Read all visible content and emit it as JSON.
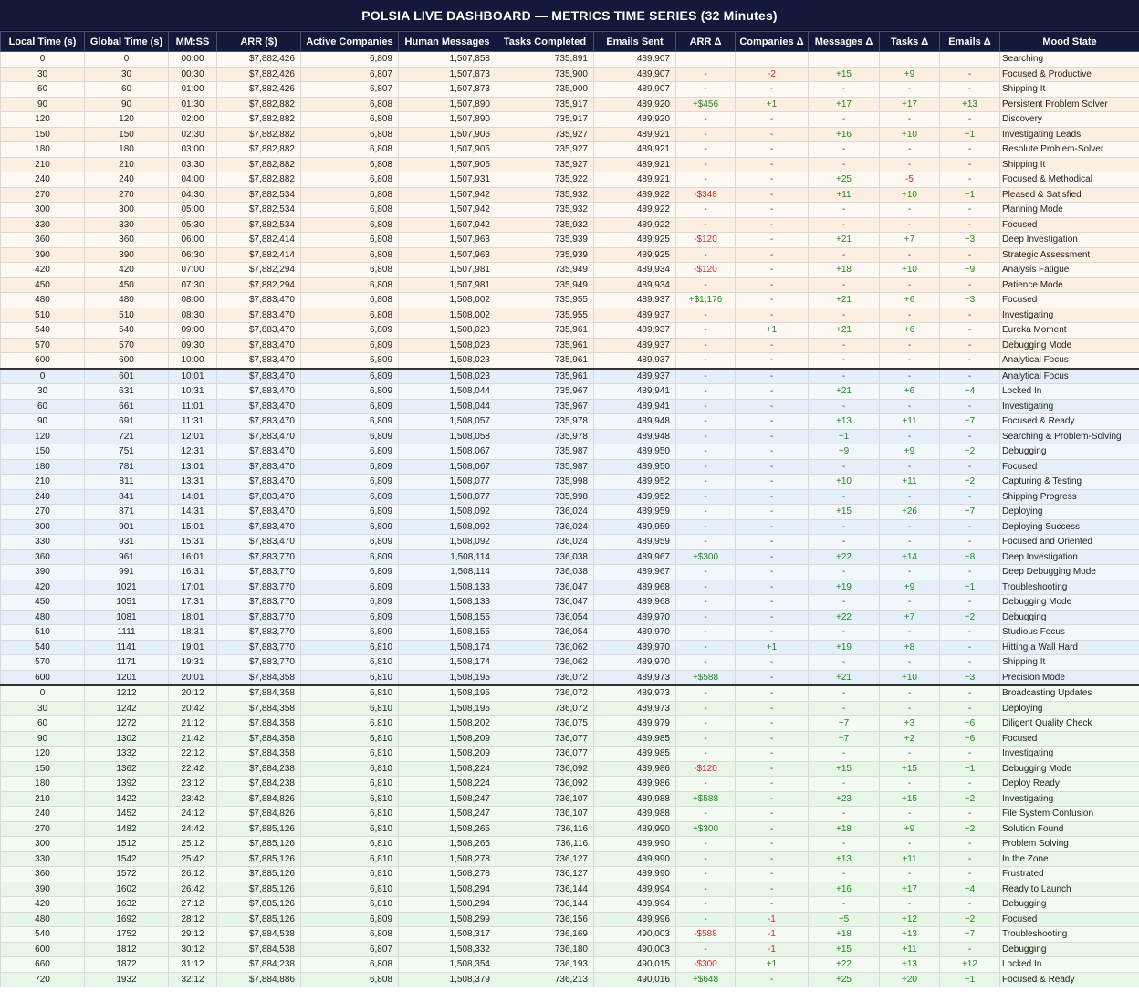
{
  "title": "POLSIA LIVE DASHBOARD — METRICS TIME SERIES (32 Minutes)",
  "columns": [
    "Local Time (s)",
    "Global Time (s)",
    "MM:SS",
    "ARR ($)",
    "Active Companies",
    "Human Messages",
    "Tasks Completed",
    "Emails Sent",
    "ARR Δ",
    "Companies Δ",
    "Messages Δ",
    "Tasks Δ",
    "Emails Δ",
    "Mood State"
  ],
  "colors": {
    "header_bg": "#13193a",
    "positive": "#1f8a1f",
    "negative": "#d12c2c"
  },
  "rows": [
    [
      "0",
      "0",
      "00:00",
      "$7,882,426",
      "6,809",
      "1,507,858",
      "735,891",
      "489,907",
      "",
      "",
      "",
      "",
      "",
      "Searching"
    ],
    [
      "30",
      "30",
      "00:30",
      "$7,882,426",
      "6,807",
      "1,507,873",
      "735,900",
      "489,907",
      "-",
      "-2",
      "+15",
      "+9",
      "-",
      "Focused & Productive"
    ],
    [
      "60",
      "60",
      "01:00",
      "$7,882,426",
      "6,807",
      "1,507,873",
      "735,900",
      "489,907",
      "-",
      "-",
      "-",
      "-",
      "-",
      "Shipping It"
    ],
    [
      "90",
      "90",
      "01:30",
      "$7,882,882",
      "6,808",
      "1,507,890",
      "735,917",
      "489,920",
      "+$456",
      "+1",
      "+17",
      "+17",
      "+13",
      "Persistent Problem Solver"
    ],
    [
      "120",
      "120",
      "02:00",
      "$7,882,882",
      "6,808",
      "1,507,890",
      "735,917",
      "489,920",
      "-",
      "-",
      "-",
      "-",
      "-",
      "Discovery"
    ],
    [
      "150",
      "150",
      "02:30",
      "$7,882,882",
      "6,808",
      "1,507,906",
      "735,927",
      "489,921",
      "-",
      "-",
      "+16",
      "+10",
      "+1",
      "Investigating Leads"
    ],
    [
      "180",
      "180",
      "03:00",
      "$7,882,882",
      "6,808",
      "1,507,906",
      "735,927",
      "489,921",
      "-",
      "-",
      "-",
      "-",
      "-",
      "Resolute Problem-Solver"
    ],
    [
      "210",
      "210",
      "03:30",
      "$7,882,882",
      "6,808",
      "1,507,906",
      "735,927",
      "489,921",
      "-",
      "-",
      "-",
      "-",
      "-",
      "Shipping It"
    ],
    [
      "240",
      "240",
      "04:00",
      "$7,882,882",
      "6,808",
      "1,507,931",
      "735,922",
      "489,921",
      "-",
      "-",
      "+25",
      "-5",
      "-",
      "Focused & Methodical"
    ],
    [
      "270",
      "270",
      "04:30",
      "$7,882,534",
      "6,808",
      "1,507,942",
      "735,932",
      "489,922",
      "-$348",
      "-",
      "+11",
      "+10",
      "+1",
      "Pleased & Satisfied"
    ],
    [
      "300",
      "300",
      "05:00",
      "$7,882,534",
      "6,808",
      "1,507,942",
      "735,932",
      "489,922",
      "-",
      "-",
      "-",
      "-",
      "-",
      "Planning Mode"
    ],
    [
      "330",
      "330",
      "05:30",
      "$7,882,534",
      "6,808",
      "1,507,942",
      "735,932",
      "489,922",
      "-",
      "-",
      "-",
      "-",
      "-",
      "Focused"
    ],
    [
      "360",
      "360",
      "06:00",
      "$7,882,414",
      "6,808",
      "1,507,963",
      "735,939",
      "489,925",
      "-$120",
      "-",
      "+21",
      "+7",
      "+3",
      "Deep Investigation"
    ],
    [
      "390",
      "390",
      "06:30",
      "$7,882,414",
      "6,808",
      "1,507,963",
      "735,939",
      "489,925",
      "-",
      "-",
      "-",
      "-",
      "-",
      "Strategic Assessment"
    ],
    [
      "420",
      "420",
      "07:00",
      "$7,882,294",
      "6,808",
      "1,507,981",
      "735,949",
      "489,934",
      "-$120",
      "-",
      "+18",
      "+10",
      "+9",
      "Analysis Fatigue"
    ],
    [
      "450",
      "450",
      "07:30",
      "$7,882,294",
      "6,808",
      "1,507,981",
      "735,949",
      "489,934",
      "-",
      "-",
      "-",
      "-",
      "-",
      "Patience Mode"
    ],
    [
      "480",
      "480",
      "08:00",
      "$7,883,470",
      "6,808",
      "1,508,002",
      "735,955",
      "489,937",
      "+$1,176",
      "-",
      "+21",
      "+6",
      "+3",
      "Focused"
    ],
    [
      "510",
      "510",
      "08:30",
      "$7,883,470",
      "6,808",
      "1,508,002",
      "735,955",
      "489,937",
      "-",
      "-",
      "-",
      "-",
      "-",
      "Investigating"
    ],
    [
      "540",
      "540",
      "09:00",
      "$7,883,470",
      "6,809",
      "1,508,023",
      "735,961",
      "489,937",
      "-",
      "+1",
      "+21",
      "+6",
      "-",
      "Eureka Moment"
    ],
    [
      "570",
      "570",
      "09:30",
      "$7,883,470",
      "6,809",
      "1,508,023",
      "735,961",
      "489,937",
      "-",
      "-",
      "-",
      "-",
      "-",
      "Debugging Mode"
    ],
    [
      "600",
      "600",
      "10:00",
      "$7,883,470",
      "6,809",
      "1,508,023",
      "735,961",
      "489,937",
      "-",
      "-",
      "-",
      "-",
      "-",
      "Analytical Focus"
    ],
    [
      "0",
      "601",
      "10:01",
      "$7,883,470",
      "6,809",
      "1,508,023",
      "735,961",
      "489,937",
      "-",
      "-",
      "-",
      "-",
      "-",
      "Analytical Focus"
    ],
    [
      "30",
      "631",
      "10:31",
      "$7,883,470",
      "6,809",
      "1,508,044",
      "735,967",
      "489,941",
      "-",
      "-",
      "+21",
      "+6",
      "+4",
      "Locked In"
    ],
    [
      "60",
      "661",
      "11:01",
      "$7,883,470",
      "6,809",
      "1,508,044",
      "735,967",
      "489,941",
      "-",
      "-",
      "-",
      "-",
      "-",
      "Investigating"
    ],
    [
      "90",
      "691",
      "11:31",
      "$7,883,470",
      "6,809",
      "1,508,057",
      "735,978",
      "489,948",
      "-",
      "-",
      "+13",
      "+11",
      "+7",
      "Focused & Ready"
    ],
    [
      "120",
      "721",
      "12:01",
      "$7,883,470",
      "6,809",
      "1,508,058",
      "735,978",
      "489,948",
      "-",
      "-",
      "+1",
      "-",
      "-",
      "Searching & Problem-Solving"
    ],
    [
      "150",
      "751",
      "12:31",
      "$7,883,470",
      "6,809",
      "1,508,067",
      "735,987",
      "489,950",
      "-",
      "-",
      "+9",
      "+9",
      "+2",
      "Debugging"
    ],
    [
      "180",
      "781",
      "13:01",
      "$7,883,470",
      "6,809",
      "1,508,067",
      "735,987",
      "489,950",
      "-",
      "-",
      "-",
      "-",
      "-",
      "Focused"
    ],
    [
      "210",
      "811",
      "13:31",
      "$7,883,470",
      "6,809",
      "1,508,077",
      "735,998",
      "489,952",
      "-",
      "-",
      "+10",
      "+11",
      "+2",
      "Capturing & Testing"
    ],
    [
      "240",
      "841",
      "14:01",
      "$7,883,470",
      "6,809",
      "1,508,077",
      "735,998",
      "489,952",
      "-",
      "-",
      "-",
      "-",
      "-",
      "Shipping Progress"
    ],
    [
      "270",
      "871",
      "14:31",
      "$7,883,470",
      "6,809",
      "1,508,092",
      "736,024",
      "489,959",
      "-",
      "-",
      "+15",
      "+26",
      "+7",
      "Deploying"
    ],
    [
      "300",
      "901",
      "15:01",
      "$7,883,470",
      "6,809",
      "1,508,092",
      "736,024",
      "489,959",
      "-",
      "-",
      "-",
      "-",
      "-",
      "Deploying Success"
    ],
    [
      "330",
      "931",
      "15:31",
      "$7,883,470",
      "6,809",
      "1,508,092",
      "736,024",
      "489,959",
      "-",
      "-",
      "-",
      "-",
      "-",
      "Focused and Oriented"
    ],
    [
      "360",
      "961",
      "16:01",
      "$7,883,770",
      "6,809",
      "1,508,114",
      "736,038",
      "489,967",
      "+$300",
      "-",
      "+22",
      "+14",
      "+8",
      "Deep Investigation"
    ],
    [
      "390",
      "991",
      "16:31",
      "$7,883,770",
      "6,809",
      "1,508,114",
      "736,038",
      "489,967",
      "-",
      "-",
      "-",
      "-",
      "-",
      "Deep Debugging Mode"
    ],
    [
      "420",
      "1021",
      "17:01",
      "$7,883,770",
      "6,809",
      "1,508,133",
      "736,047",
      "489,968",
      "-",
      "-",
      "+19",
      "+9",
      "+1",
      "Troubleshooting"
    ],
    [
      "450",
      "1051",
      "17:31",
      "$7,883,770",
      "6,809",
      "1,508,133",
      "736,047",
      "489,968",
      "-",
      "-",
      "-",
      "-",
      "-",
      "Debugging Mode"
    ],
    [
      "480",
      "1081",
      "18:01",
      "$7,883,770",
      "6,809",
      "1,508,155",
      "736,054",
      "489,970",
      "-",
      "-",
      "+22",
      "+7",
      "+2",
      "Debugging"
    ],
    [
      "510",
      "1111",
      "18:31",
      "$7,883,770",
      "6,809",
      "1,508,155",
      "736,054",
      "489,970",
      "-",
      "-",
      "-",
      "-",
      "-",
      "Studious Focus"
    ],
    [
      "540",
      "1141",
      "19:01",
      "$7,883,770",
      "6,810",
      "1,508,174",
      "736,062",
      "489,970",
      "-",
      "+1",
      "+19",
      "+8",
      "-",
      "Hitting a Wall Hard"
    ],
    [
      "570",
      "1171",
      "19:31",
      "$7,883,770",
      "6,810",
      "1,508,174",
      "736,062",
      "489,970",
      "-",
      "-",
      "-",
      "-",
      "-",
      "Shipping It"
    ],
    [
      "600",
      "1201",
      "20:01",
      "$7,884,358",
      "6,810",
      "1,508,195",
      "736,072",
      "489,973",
      "+$588",
      "-",
      "+21",
      "+10",
      "+3",
      "Precision Mode"
    ],
    [
      "0",
      "1212",
      "20:12",
      "$7,884,358",
      "6,810",
      "1,508,195",
      "736,072",
      "489,973",
      "-",
      "-",
      "-",
      "-",
      "-",
      "Broadcasting Updates"
    ],
    [
      "30",
      "1242",
      "20:42",
      "$7,884,358",
      "6,810",
      "1,508,195",
      "736,072",
      "489,973",
      "-",
      "-",
      "-",
      "-",
      "-",
      "Deploying"
    ],
    [
      "60",
      "1272",
      "21:12",
      "$7,884,358",
      "6,810",
      "1,508,202",
      "736,075",
      "489,979",
      "-",
      "-",
      "+7",
      "+3",
      "+6",
      "Diligent Quality Check"
    ],
    [
      "90",
      "1302",
      "21:42",
      "$7,884,358",
      "6,810",
      "1,508,209",
      "736,077",
      "489,985",
      "-",
      "-",
      "+7",
      "+2",
      "+6",
      "Focused"
    ],
    [
      "120",
      "1332",
      "22:12",
      "$7,884,358",
      "6,810",
      "1,508,209",
      "736,077",
      "489,985",
      "-",
      "-",
      "-",
      "-",
      "-",
      "Investigating"
    ],
    [
      "150",
      "1362",
      "22:42",
      "$7,884,238",
      "6,810",
      "1,508,224",
      "736,092",
      "489,986",
      "-$120",
      "-",
      "+15",
      "+15",
      "+1",
      "Debugging Mode"
    ],
    [
      "180",
      "1392",
      "23:12",
      "$7,884,238",
      "6,810",
      "1,508,224",
      "736,092",
      "489,986",
      "-",
      "-",
      "-",
      "-",
      "-",
      "Deploy Ready"
    ],
    [
      "210",
      "1422",
      "23:42",
      "$7,884,826",
      "6,810",
      "1,508,247",
      "736,107",
      "489,988",
      "+$588",
      "-",
      "+23",
      "+15",
      "+2",
      "Investigating"
    ],
    [
      "240",
      "1452",
      "24:12",
      "$7,884,826",
      "6,810",
      "1,508,247",
      "736,107",
      "489,988",
      "-",
      "-",
      "-",
      "-",
      "-",
      "File System Confusion"
    ],
    [
      "270",
      "1482",
      "24:42",
      "$7,885,126",
      "6,810",
      "1,508,265",
      "736,116",
      "489,990",
      "+$300",
      "-",
      "+18",
      "+9",
      "+2",
      "Solution Found"
    ],
    [
      "300",
      "1512",
      "25:12",
      "$7,885,126",
      "6,810",
      "1,508,265",
      "736,116",
      "489,990",
      "-",
      "-",
      "-",
      "-",
      "-",
      "Problem Solving"
    ],
    [
      "330",
      "1542",
      "25:42",
      "$7,885,126",
      "6,810",
      "1,508,278",
      "736,127",
      "489,990",
      "-",
      "-",
      "+13",
      "+11",
      "-",
      "In the Zone"
    ],
    [
      "360",
      "1572",
      "26:12",
      "$7,885,126",
      "6,810",
      "1,508,278",
      "736,127",
      "489,990",
      "-",
      "-",
      "-",
      "-",
      "-",
      "Frustrated"
    ],
    [
      "390",
      "1602",
      "26:42",
      "$7,885,126",
      "6,810",
      "1,508,294",
      "736,144",
      "489,994",
      "-",
      "-",
      "+16",
      "+17",
      "+4",
      "Ready to Launch"
    ],
    [
      "420",
      "1632",
      "27:12",
      "$7,885,126",
      "6,810",
      "1,508,294",
      "736,144",
      "489,994",
      "-",
      "-",
      "-",
      "-",
      "-",
      "Debugging"
    ],
    [
      "480",
      "1692",
      "28:12",
      "$7,885,126",
      "6,809",
      "1,508,299",
      "736,156",
      "489,996",
      "-",
      "-1",
      "+5",
      "+12",
      "+2",
      "Focused"
    ],
    [
      "540",
      "1752",
      "29:12",
      "$7,884,538",
      "6,808",
      "1,508,317",
      "736,169",
      "490,003",
      "-$588",
      "-1",
      "+18",
      "+13",
      "+7",
      "Troubleshooting"
    ],
    [
      "600",
      "1812",
      "30:12",
      "$7,884,538",
      "6,807",
      "1,508,332",
      "736,180",
      "490,003",
      "-",
      "-1",
      "+15",
      "+11",
      "-",
      "Debugging"
    ],
    [
      "660",
      "1872",
      "31:12",
      "$7,884,238",
      "6,808",
      "1,508,354",
      "736,193",
      "490,015",
      "-$300",
      "+1",
      "+22",
      "+13",
      "+12",
      "Locked In"
    ],
    [
      "720",
      "1932",
      "32:12",
      "$7,884,886",
      "6,808",
      "1,508,379",
      "736,213",
      "490,016",
      "+$648",
      "-",
      "+25",
      "+20",
      "+1",
      "Focused & Ready"
    ]
  ]
}
